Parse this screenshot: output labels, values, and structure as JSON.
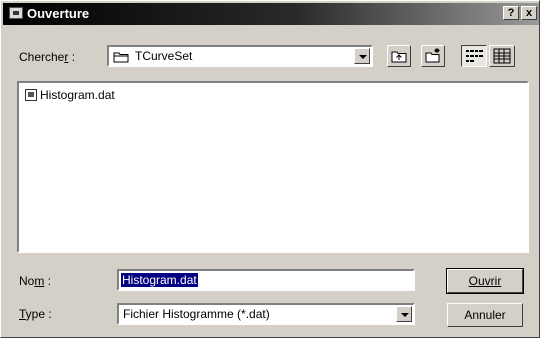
{
  "window": {
    "title": "Ouverture",
    "help_label": "?",
    "close_label": "x"
  },
  "lookin": {
    "label_before": "Cherche",
    "label_accel": "r",
    "label_after": " :",
    "value": "TCurveSet"
  },
  "toolbar": {
    "up_icon": "up-folder-icon",
    "new_folder_icon": "new-folder-icon",
    "list_view_icon": "list-view-icon",
    "details_view_icon": "details-view-icon"
  },
  "files": [
    {
      "name": "Histogram.dat",
      "icon": "document-icon"
    }
  ],
  "filename": {
    "label_before": "No",
    "label_accel": "m",
    "label_after": " :",
    "value": "Histogram.dat"
  },
  "filetype": {
    "label_accel": "T",
    "label_after": "ype :",
    "value": "Fichier Histogramme (*.dat)"
  },
  "buttons": {
    "open_label": "Ouvrir",
    "cancel_label": "Annuler"
  }
}
